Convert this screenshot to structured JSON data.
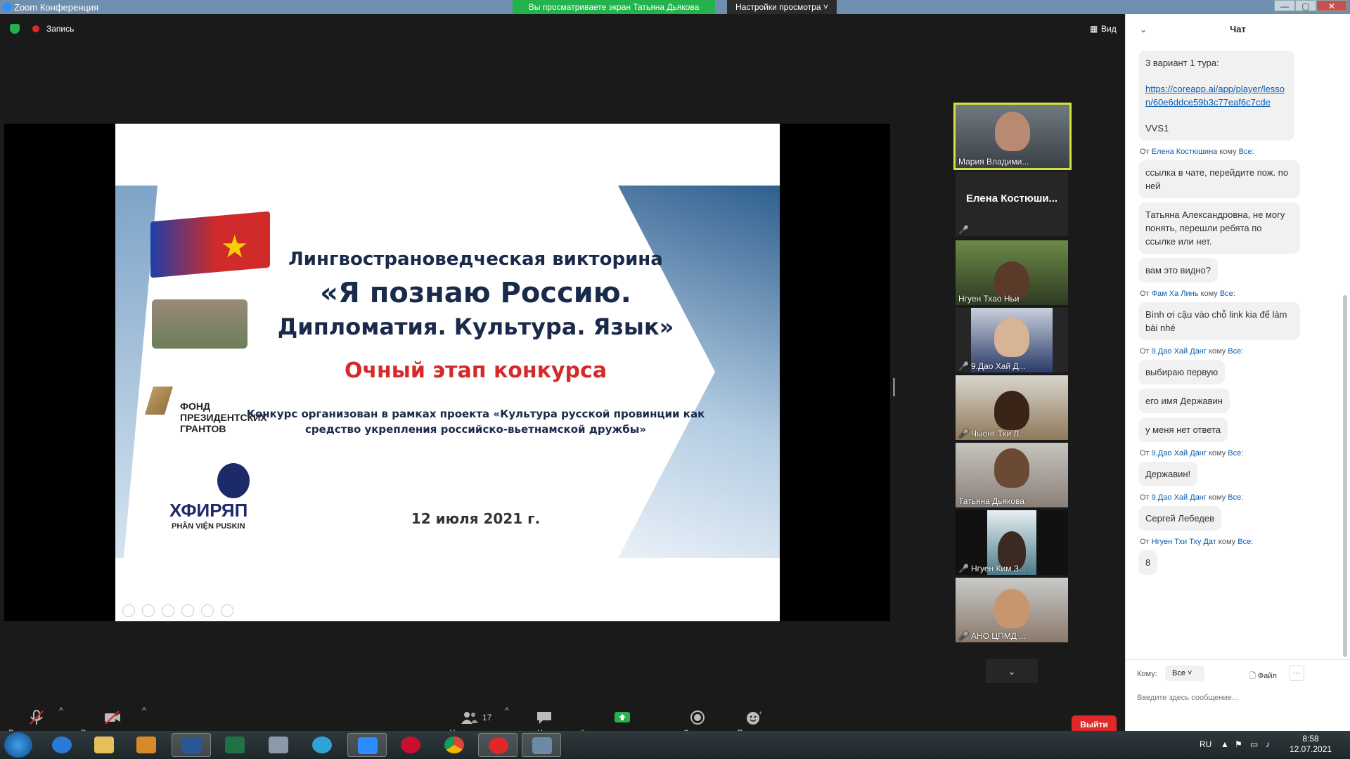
{
  "window": {
    "app_title": "Zoom Конференция",
    "viewing_banner": "Вы просматриваете экран Татьяна Дьякова",
    "view_settings": "Настройки просмотра ˅",
    "min": "—",
    "max": "▢",
    "close": "✕"
  },
  "topbar": {
    "record_label": "Запись",
    "view_label": "Вид"
  },
  "slide": {
    "title1": "Лингвострановедческая викторина",
    "title2": "«Я познаю Россию.",
    "title3": "Дипломатия. Культура. Язык»",
    "stage": "Очный этап конкурса",
    "project_line1": "Конкурс организован в рамках проекта «Культура русской провинции как",
    "project_line2": "средство укрепления российско-вьетнамской дружбы»",
    "date": "12 июля 2021 г.",
    "fund_line1": "ФОНД",
    "fund_line2": "ПРЕЗИДЕНТСКИХ",
    "fund_line3": "ГРАНТОВ",
    "logo_main": "ХФИРЯП",
    "logo_sub": "PHÂN VIỆN PUSKIN"
  },
  "participants": [
    {
      "name": "Мария Владими...",
      "muted": false
    },
    {
      "name": "Елена  Костюши...",
      "muted": true
    },
    {
      "name": "Нгуен Тхао Ньи",
      "muted": false
    },
    {
      "name": "9.Дао Хай Д...",
      "muted": true
    },
    {
      "name": "Чыонг Тхи Л...",
      "muted": true
    },
    {
      "name": "Татьяна Дьякова",
      "muted": false
    },
    {
      "name": "Нгуен Ким З...",
      "muted": true
    },
    {
      "name": "АНО ЦПМД ...",
      "muted": true
    }
  ],
  "toolbar": {
    "mute": "Включить звук",
    "video": "Включить видео",
    "participants": "Участники",
    "participants_count": "17",
    "chat": "Чат",
    "share": "Демонстрация экрана",
    "record": "Запись",
    "reactions": "Реакции",
    "leave": "Выйти"
  },
  "chat": {
    "title": "Чат",
    "first_message": {
      "line1": "3 вариант 1 тура:",
      "link": "https://coreapp.ai/app/player/lesson/60e6ddce59b3c77eaf6c7cde",
      "line2": "VVS1"
    },
    "groups": [
      {
        "from": "Елена Костюшина",
        "to": "Все:",
        "messages": [
          "ссылка в чате, перейдите пож. по ней",
          "Татьяна Александровна, не могу понять, перешли ребята по ссылке или нет.",
          "вам это видно?"
        ]
      },
      {
        "from": "Фам Ха Линь",
        "to": "Все:",
        "messages": [
          "Bình ơi cậu vào chỗ link kia để làm bài nhé"
        ]
      },
      {
        "from": "9.Дао Хай Данг",
        "to": "Все:",
        "messages": [
          "выбираю первую",
          "его имя Державин",
          "у меня нет ответа"
        ]
      },
      {
        "from": "9.Дао Хай Данг",
        "to": "Все:",
        "messages": [
          "Державин!"
        ]
      },
      {
        "from": "9.Дао Хай Данг",
        "to": "Все:",
        "messages": [
          "Сергей Лебедев"
        ]
      },
      {
        "from": "Нгуен Тхи Тху Дат",
        "to": "Все:",
        "messages": [
          "8"
        ]
      }
    ],
    "from_word": "От",
    "to_word": "кому",
    "recipient_label": "Кому:",
    "recipient_value": "Все ˅",
    "file_label": "Файл",
    "more_label": "···",
    "input_placeholder": "Введите здесь сообщение..."
  },
  "taskbar": {
    "lang": "RU",
    "time": "8:58",
    "date": "12.07.2021"
  }
}
